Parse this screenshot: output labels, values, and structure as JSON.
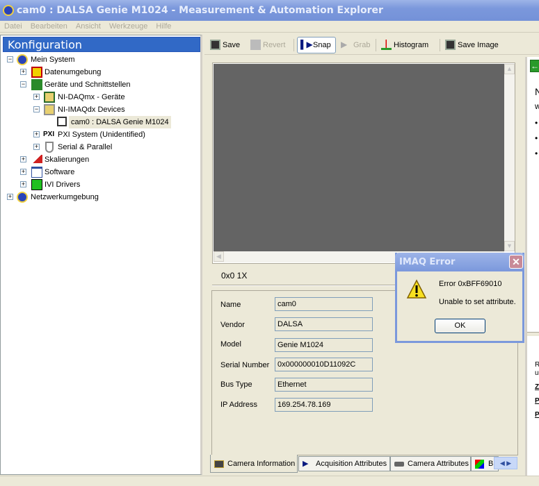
{
  "window": {
    "title": "cam0 : DALSA Genie M1024 - Measurement & Automation Explorer"
  },
  "menu": [
    "Datei",
    "Bearbeiten",
    "Ansicht",
    "Werkzeuge",
    "Hilfe"
  ],
  "left": {
    "header": "Konfiguration",
    "tree": [
      "Mein System",
      "Datenumgebung",
      "Geräte und Schnittstellen",
      "NI-DAQmx - Geräte",
      "NI-IMAQdx Devices",
      "cam0 : DALSA Genie M1024",
      "PXI System (Unidentified)",
      "Serial & Parallel",
      "Skalierungen",
      "Software",
      "IVI Drivers",
      "Netzwerkumgebung"
    ]
  },
  "toolbar": {
    "save": "Save",
    "revert": "Revert",
    "snap": "Snap",
    "grab": "Grab",
    "histogram": "Histogram",
    "save_image": "Save Image"
  },
  "viewer": {
    "zoom_info": "0x0  1X"
  },
  "info": {
    "fields": [
      {
        "label": "Name",
        "value": "cam0"
      },
      {
        "label": "Vendor",
        "value": "DALSA"
      },
      {
        "label": "Model",
        "value": "Genie M1024"
      },
      {
        "label": "Serial Number",
        "value": "0x000000010D11092C"
      },
      {
        "label": "Bus Type",
        "value": "Ethernet"
      },
      {
        "label": "IP Address",
        "value": "169.254.78.169"
      }
    ]
  },
  "tabs": [
    "Camera Information",
    "Acquisition Attributes",
    "Camera Attributes",
    "B"
  ],
  "right_pane": {
    "back": "←",
    "t1": "N",
    "t2": "w",
    "b1": "•",
    "b2": "•",
    "b3": "•",
    "t3": "R",
    "t4": "u",
    "l1": "Z",
    "l2": "P",
    "l3": "P"
  },
  "dialog": {
    "title": "IMAQ Error",
    "close": "✕",
    "code": "Error 0xBFF69010",
    "message": "Unable to set attribute.",
    "ok": "OK"
  }
}
